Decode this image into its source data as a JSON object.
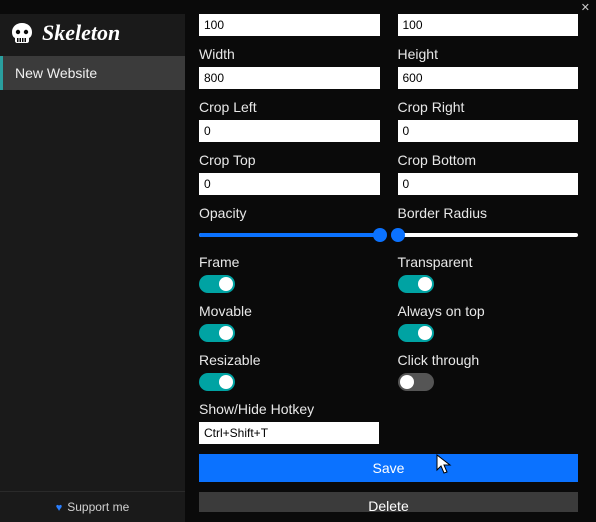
{
  "sidebar": {
    "brand": "Skeleton",
    "item": "New Website",
    "support": "Support me"
  },
  "fields": {
    "topL": "100",
    "topR": "100",
    "width_label": "Width",
    "width": "800",
    "height_label": "Height",
    "height": "600",
    "cropL_label": "Crop Left",
    "cropL": "0",
    "cropR_label": "Crop Right",
    "cropR": "0",
    "cropT_label": "Crop Top",
    "cropT": "0",
    "cropB_label": "Crop Bottom",
    "cropB": "0",
    "opacity_label": "Opacity",
    "radius_label": "Border Radius",
    "frame_label": "Frame",
    "transparent_label": "Transparent",
    "movable_label": "Movable",
    "ontop_label": "Always on top",
    "resizable_label": "Resizable",
    "click_label": "Click through",
    "hotkey_label": "Show/Hide Hotkey",
    "hotkey": "Ctrl+Shift+T"
  },
  "buttons": {
    "save": "Save",
    "delete": "Delete"
  },
  "toggles": {
    "frame": true,
    "transparent": true,
    "movable": true,
    "ontop": true,
    "resizable": true,
    "click": false
  },
  "sliders": {
    "opacity": 100,
    "radius": 0
  }
}
